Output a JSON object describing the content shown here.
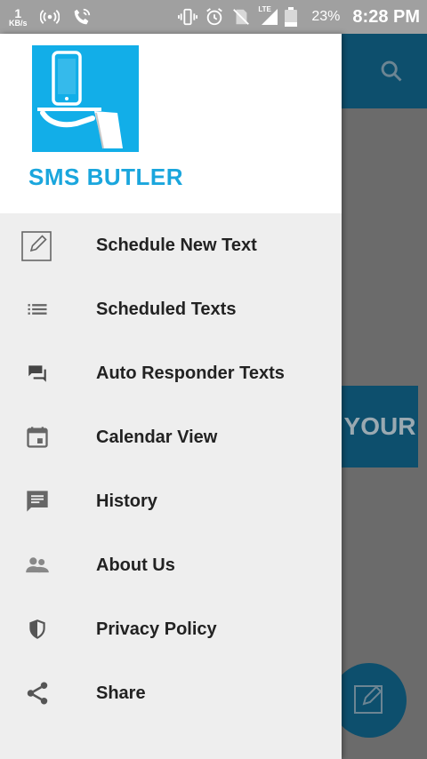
{
  "status_bar": {
    "speed_value": "1",
    "speed_unit": "KB/s",
    "network_type": "LTE",
    "battery_percent": "23%",
    "time": "8:28 PM"
  },
  "background": {
    "banner_text": "YOUR"
  },
  "drawer": {
    "app_name": "SMS BUTLER",
    "items": [
      {
        "label": "Schedule New Text",
        "icon": "edit-icon"
      },
      {
        "label": "Scheduled Texts",
        "icon": "list-icon"
      },
      {
        "label": "Auto Responder Texts",
        "icon": "chat-icon"
      },
      {
        "label": "Calendar View",
        "icon": "calendar-icon"
      },
      {
        "label": "History",
        "icon": "message-icon"
      },
      {
        "label": "About Us",
        "icon": "people-icon"
      },
      {
        "label": "Privacy Policy",
        "icon": "shield-icon"
      },
      {
        "label": "Share",
        "icon": "share-icon"
      }
    ]
  },
  "colors": {
    "brand": "#1aa6dd",
    "appbar": "#0d4f6d",
    "drawer_bg": "#eeeeee",
    "status_bar": "#a0a0a0"
  }
}
